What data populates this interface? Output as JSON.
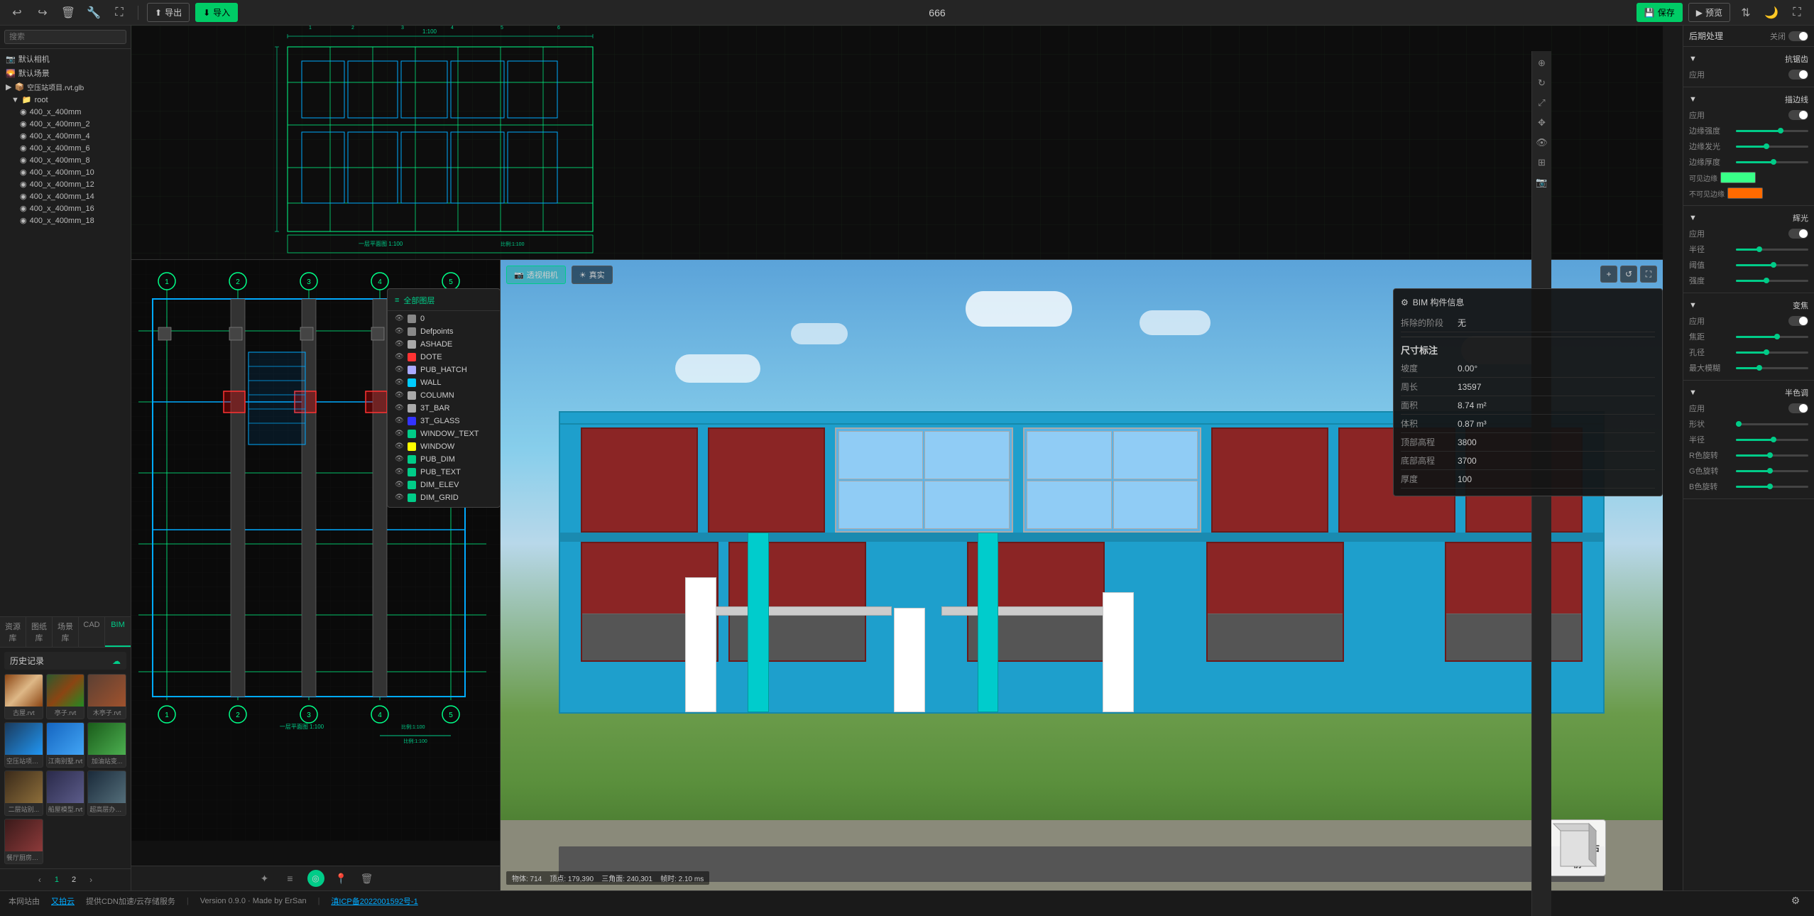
{
  "topbar": {
    "undo_label": "↩",
    "redo_label": "↪",
    "delete_label": "🗑",
    "settings_label": "🔧",
    "resize_label": "⛶",
    "export_label": "导出",
    "import_label": "导入",
    "title": "666",
    "save_label": "保存",
    "preview_label": "预览",
    "mode_label": "⚙",
    "night_label": "🌙",
    "fullscreen_label": "⛶"
  },
  "sidebar": {
    "search_placeholder": "搜索",
    "camera_default": "默认相机",
    "scene_default": "默认场景",
    "file": "空压站项目.rvt.glb",
    "root": "root",
    "items": [
      "400_x_400mm",
      "400_x_400mm_2",
      "400_x_400mm_4",
      "400_x_400mm_6",
      "400_x_400mm_8",
      "400_x_400mm_10",
      "400_x_400mm_12",
      "400_x_400mm_14",
      "400_x_400mm_16",
      "400_x_400mm_18"
    ]
  },
  "left_tabs": [
    {
      "label": "资源库",
      "active": false
    },
    {
      "label": "图纸库",
      "active": false
    },
    {
      "label": "场景库",
      "active": false
    },
    {
      "label": "CAD",
      "active": false
    },
    {
      "label": "BIM",
      "active": true
    }
  ],
  "history": {
    "title": "历史记录",
    "items": [
      {
        "label": "古屋.rvt",
        "class": "thumb-ancient"
      },
      {
        "label": "亭子.rvt",
        "class": "thumb-pavilion"
      },
      {
        "label": "木亭子.rvt",
        "class": "thumb-woodpavilion"
      },
      {
        "label": "空压站项目...",
        "class": "thumb-compress"
      },
      {
        "label": "江南别墅.rvt",
        "class": "thumb-river"
      },
      {
        "label": "加油站变...",
        "class": "thumb-chargestation"
      },
      {
        "label": "二层站别...",
        "class": "thumb-twostory"
      },
      {
        "label": "船屋模型.rvt",
        "class": "thumb-roofmodel"
      },
      {
        "label": "超高层办公...",
        "class": "thumb-highrise"
      },
      {
        "label": "餐厅厨房模...",
        "class": "thumb-restaurant"
      }
    ],
    "pagination": {
      "prev": "‹",
      "pages": [
        "1",
        "2"
      ],
      "next": "›",
      "active_page": "1"
    }
  },
  "view_controls": {
    "perspective": "透视相机",
    "realistic": "真实"
  },
  "layer_dropdown": {
    "header": "全部图层",
    "layers": [
      {
        "name": "0",
        "color": "#888",
        "visible": true
      },
      {
        "name": "Defpoints",
        "color": "#888",
        "visible": true
      },
      {
        "name": "ASHADE",
        "color": "#aaa",
        "visible": true
      },
      {
        "name": "DOTE",
        "color": "#ff3333",
        "visible": true
      },
      {
        "name": "PUB_HATCH",
        "color": "#aaaaff",
        "visible": true
      },
      {
        "name": "WALL",
        "color": "#00ccff",
        "visible": true
      },
      {
        "name": "COLUMN",
        "color": "#aaa",
        "visible": true
      },
      {
        "name": "3T_BAR",
        "color": "#aaa",
        "visible": true
      },
      {
        "name": "3T_GLASS",
        "color": "#3333ff",
        "visible": true
      },
      {
        "name": "WINDOW_TEXT",
        "color": "#00cc88",
        "visible": true
      },
      {
        "name": "WINDOW",
        "color": "#ffff00",
        "visible": true
      },
      {
        "name": "PUB_DIM",
        "color": "#00cc88",
        "visible": true
      },
      {
        "name": "PUB_TEXT",
        "color": "#00cc88",
        "visible": true
      },
      {
        "name": "DIM_ELEV",
        "color": "#00cc88",
        "visible": true
      },
      {
        "name": "DIM_GRID",
        "color": "#00cc88",
        "visible": true
      }
    ]
  },
  "bim_info": {
    "title": "BIM 构件信息",
    "demolition_stage_label": "拆除的阶段",
    "demolition_stage_value": "无",
    "dimension_title": "尺寸标注",
    "fields": [
      {
        "label": "坡度",
        "value": "0.00°"
      },
      {
        "label": "周长",
        "value": "13597"
      },
      {
        "label": "面积",
        "value": "8.74 m²"
      },
      {
        "label": "体积",
        "value": "0.87 m³"
      },
      {
        "label": "顶部高程",
        "value": "3800"
      },
      {
        "label": "底部高程",
        "value": "3700"
      },
      {
        "label": "厚度",
        "value": "100"
      }
    ]
  },
  "right_panel": {
    "title": "后期处理",
    "close_label": "关闭",
    "sections": [
      {
        "name": "抗锯齿",
        "apply_label": "应用",
        "toggle": true
      },
      {
        "name": "描边线",
        "apply_label": "应用",
        "sliders": [
          {
            "label": "边缘强度",
            "value": 60
          },
          {
            "label": "边缘发光",
            "value": 40
          },
          {
            "label": "边缘厚度",
            "value": 50
          }
        ],
        "colors": [
          {
            "label": "可见边缘",
            "color": "#39ff88",
            "hex": "#39ff88"
          },
          {
            "label": "不可见边缘",
            "color": "#ff6a00",
            "hex": "#ff6a00"
          }
        ]
      },
      {
        "name": "辉光",
        "apply_label": "应用",
        "sliders": [
          {
            "label": "半径",
            "value": 30
          },
          {
            "label": "阈值",
            "value": 50
          },
          {
            "label": "强度",
            "value": 40
          }
        ]
      },
      {
        "name": "变焦",
        "apply_label": "应用",
        "sliders": [
          {
            "label": "焦距",
            "value": 55
          },
          {
            "label": "孔径",
            "value": 40
          },
          {
            "label": "最大模糊",
            "value": 30
          }
        ]
      },
      {
        "name": "半色调",
        "apply_label": "应用",
        "sliders": [
          {
            "label": "形状",
            "value": 0
          },
          {
            "label": "半径",
            "value": 50
          },
          {
            "label": "R色旋转",
            "value": 45
          },
          {
            "label": "G色旋转",
            "value": 45
          },
          {
            "label": "B色旋转",
            "value": 45
          }
        ]
      }
    ]
  },
  "status_bar": {
    "website_label": "本网站由",
    "logo_label": "又拍云",
    "cdn_label": "提供CDN加速/云存储服务",
    "version_label": "Version 0.9.0 · Made by ErSan",
    "icp_label": "滇ICP备2022001592号-1",
    "objects": "物体: 714",
    "vertices": "顶点: 179,390",
    "triangles": "三角面: 240,301",
    "render_time": "帧时: 2.10 ms"
  },
  "compass": {
    "front": "前",
    "right": "右"
  }
}
